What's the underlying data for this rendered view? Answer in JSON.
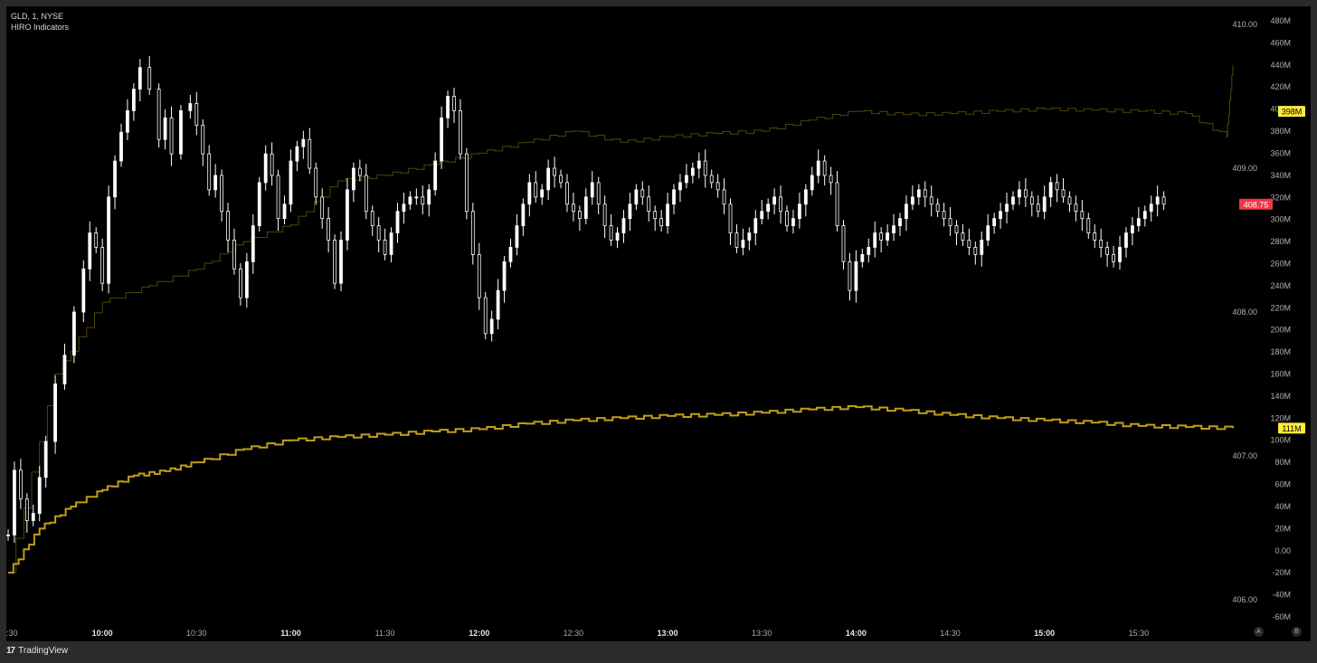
{
  "legend": {
    "line1": "GLD, 1, NYSE",
    "line2": "HIRO Indicators"
  },
  "brand": {
    "logo": "17",
    "name": "TradingView"
  },
  "corner_buttons": [
    "A",
    "B"
  ],
  "chart_data": {
    "type": "candlestick+line",
    "x_ticks": [
      ":30",
      "10:00",
      "10:30",
      "11:00",
      "11:30",
      "12:00",
      "12:30",
      "13:00",
      "13:30",
      "14:00",
      "14:30",
      "15:00",
      "15:30"
    ],
    "x_ticks_bold": [
      "10:00",
      "11:00",
      "12:00",
      "13:00",
      "14:00",
      "15:00"
    ],
    "price_axis": {
      "labels": [
        "410.00",
        "409.00",
        "408.00",
        "407.00",
        "406.00"
      ],
      "last_price": "408.75",
      "last_price_color": "#f23645"
    },
    "hiro_axis": {
      "labels": [
        "480M",
        "460M",
        "440M",
        "420M",
        "400M",
        "380M",
        "360M",
        "340M",
        "320M",
        "300M",
        "280M",
        "260M",
        "240M",
        "220M",
        "200M",
        "180M",
        "160M",
        "140M",
        "120M",
        "100M",
        "80M",
        "60M",
        "40M",
        "20M",
        "0.00",
        "-20M",
        "-40M",
        "-60M"
      ],
      "badge_upper": "398M",
      "badge_lower": "111M",
      "badge_color": "#ffeb3b"
    },
    "series": [
      {
        "kind": "candles",
        "color_up": "#ffffff",
        "color_down": "#ffffff",
        "x_minutes": [
          0,
          10,
          20,
          30,
          45,
          60,
          75,
          90,
          105,
          120,
          135,
          150,
          165,
          180,
          195,
          210,
          225,
          240,
          255,
          270,
          285,
          300,
          315,
          330,
          345,
          360,
          375,
          390
        ],
        "close": [
          406.55,
          407.55,
          408.9,
          409.7,
          409.35,
          408.4,
          408.95,
          409.05,
          408.6,
          409.0,
          408.65,
          408.65,
          409.05,
          409.4,
          407.85,
          408.9,
          408.8,
          409.1,
          408.5,
          408.8,
          409.1,
          408.45,
          408.8,
          408.75,
          408.45,
          408.85,
          408.35,
          408.75
        ],
        "path_x": [
          0,
          2,
          4,
          6,
          8,
          10,
          12,
          15,
          18,
          21,
          24,
          26,
          28,
          30,
          32,
          34,
          36,
          38,
          40,
          42,
          45,
          48,
          50,
          52,
          55,
          58,
          60,
          62,
          64,
          66,
          68,
          70,
          72,
          74,
          76,
          78,
          80,
          82,
          84,
          86,
          88,
          90,
          92,
          94,
          96,
          98,
          100,
          102,
          104,
          106,
          108,
          110,
          112,
          114,
          116,
          118,
          120,
          122,
          124,
          126,
          128,
          130,
          132,
          134,
          136,
          138,
          140,
          142,
          144,
          146,
          148,
          150,
          152,
          154,
          156,
          158,
          160,
          162,
          164,
          166,
          168,
          170,
          172,
          174,
          176,
          178,
          180,
          182,
          184,
          186,
          188,
          190,
          192,
          194,
          196,
          198,
          200,
          202,
          204,
          206,
          208,
          210,
          212,
          214,
          216,
          218,
          220,
          222,
          224,
          226,
          228,
          230,
          232,
          234,
          236,
          238,
          240,
          242,
          244,
          246,
          248,
          250,
          252,
          254,
          256,
          258,
          260,
          262,
          264,
          266,
          268,
          270,
          272,
          274,
          276,
          278,
          280,
          282,
          284,
          286,
          288,
          290,
          292,
          294,
          296,
          298,
          300,
          302,
          304,
          306,
          308,
          310,
          312,
          314,
          316,
          318,
          320,
          322,
          324,
          326,
          328,
          330,
          332,
          334,
          336,
          338,
          340,
          342,
          344,
          346,
          348,
          350,
          352,
          354,
          356,
          358,
          360,
          362,
          364,
          366,
          368,
          370,
          372,
          374,
          376,
          378,
          380,
          382,
          384,
          386,
          388,
          390
        ],
        "path_close": [
          406.45,
          406.9,
          406.7,
          406.55,
          406.6,
          406.85,
          407.1,
          407.5,
          407.7,
          408.0,
          408.3,
          408.55,
          408.45,
          408.2,
          408.8,
          409.05,
          409.25,
          409.4,
          409.55,
          409.7,
          409.55,
          409.2,
          409.35,
          409.1,
          409.4,
          409.45,
          409.3,
          409.1,
          408.85,
          408.95,
          408.7,
          408.5,
          408.3,
          408.1,
          408.35,
          408.6,
          408.9,
          409.1,
          408.95,
          408.65,
          408.75,
          409.05,
          409.15,
          409.2,
          409.0,
          408.8,
          408.65,
          408.5,
          408.2,
          408.5,
          408.85,
          409.0,
          408.95,
          408.7,
          408.6,
          408.5,
          408.4,
          408.55,
          408.7,
          408.75,
          408.8,
          408.8,
          408.75,
          408.85,
          409.05,
          409.35,
          409.5,
          409.4,
          409.1,
          408.7,
          408.4,
          408.1,
          407.85,
          407.95,
          408.15,
          408.35,
          408.45,
          408.6,
          408.75,
          408.9,
          408.8,
          408.85,
          409.0,
          408.95,
          408.9,
          408.75,
          408.7,
          408.65,
          408.8,
          408.9,
          408.75,
          408.6,
          408.5,
          408.55,
          408.65,
          408.75,
          408.85,
          408.8,
          408.7,
          408.65,
          408.6,
          408.75,
          408.85,
          408.9,
          408.95,
          409.0,
          409.05,
          408.95,
          408.9,
          408.85,
          408.75,
          408.55,
          408.45,
          408.5,
          408.55,
          408.65,
          408.7,
          408.75,
          408.8,
          408.7,
          408.6,
          408.65,
          408.75,
          408.85,
          408.95,
          409.05,
          408.95,
          408.9,
          408.6,
          408.35,
          408.15,
          408.35,
          408.4,
          408.45,
          408.55,
          408.5,
          408.55,
          408.6,
          408.65,
          408.75,
          408.8,
          408.85,
          408.8,
          408.75,
          408.7,
          408.65,
          408.6,
          408.55,
          408.5,
          408.45,
          408.4,
          408.5,
          408.6,
          408.65,
          408.7,
          408.75,
          408.8,
          408.85,
          408.8,
          408.75,
          408.7,
          408.8,
          408.9,
          408.85,
          408.8,
          408.75,
          408.7,
          408.65,
          408.55,
          408.5,
          408.45,
          408.4,
          408.35,
          408.45,
          408.55,
          408.6,
          408.65,
          408.7,
          408.75,
          408.8,
          408.75
        ],
        "label": ""
      },
      {
        "kind": "hiro_step_upper",
        "color": "#b59a10",
        "x_minutes": [
          0,
          15,
          30,
          45,
          60,
          75,
          90,
          105,
          120,
          135,
          150,
          165,
          180,
          195,
          210,
          225,
          240,
          255,
          270,
          285,
          300,
          315,
          330,
          345,
          360,
          375,
          388,
          390
        ],
        "y_millions": [
          -20,
          160,
          225,
          240,
          255,
          280,
          295,
          335,
          340,
          350,
          360,
          370,
          380,
          370,
          375,
          378,
          380,
          390,
          398,
          395,
          396,
          398,
          400,
          399,
          398,
          396,
          375,
          440
        ]
      },
      {
        "kind": "hiro_step_lower",
        "color": "#c9a61a",
        "x_minutes": [
          0,
          10,
          20,
          30,
          40,
          50,
          60,
          75,
          90,
          105,
          120,
          135,
          150,
          165,
          180,
          195,
          210,
          225,
          240,
          255,
          270,
          285,
          300,
          315,
          330,
          345,
          360,
          375,
          390
        ],
        "y_millions": [
          -20,
          20,
          40,
          55,
          68,
          72,
          80,
          92,
          100,
          103,
          105,
          108,
          110,
          115,
          118,
          120,
          122,
          123,
          125,
          128,
          130,
          127,
          123,
          120,
          118,
          116,
          113,
          112,
          111
        ]
      }
    ],
    "grid": false
  }
}
